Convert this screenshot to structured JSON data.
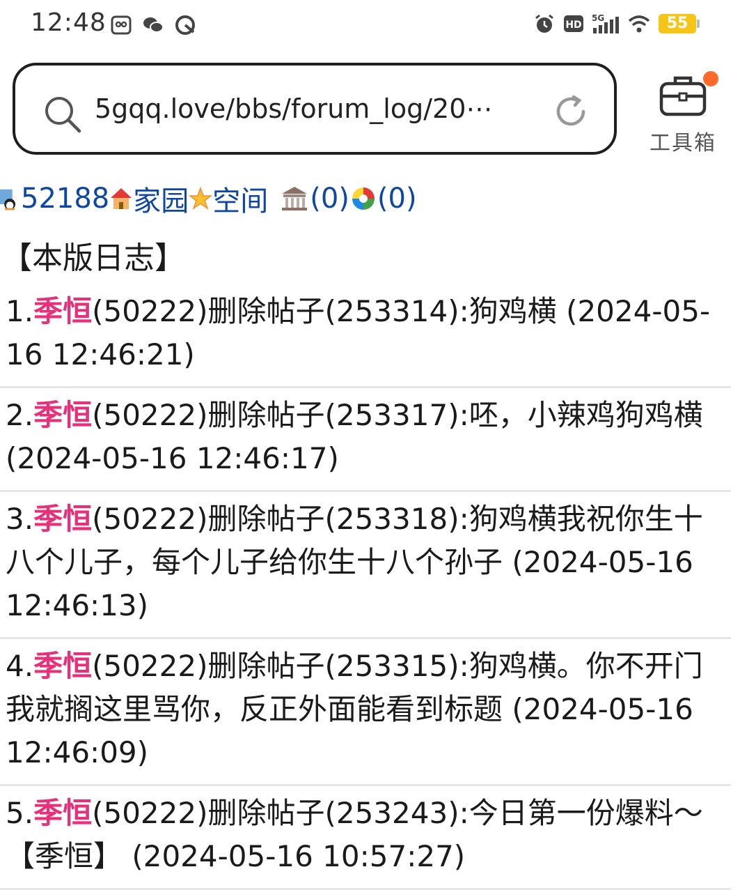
{
  "status_bar": {
    "time": "12:48",
    "battery": "55",
    "network": "5G",
    "hd": "HD"
  },
  "address_bar": {
    "url": "5gqq.love/bbs/forum_log/20⋯",
    "toolbox_label": "工具箱"
  },
  "nav": {
    "user_id": "52188",
    "home": "家园",
    "space": "空间",
    "count1": "(0)",
    "count2": "(0)"
  },
  "section_title": "【本版日志】",
  "logs": [
    {
      "num": "1.",
      "user": "季恒",
      "text": "(50222)删除帖子(253314):狗鸡横 (2024-05-16 12:46:21)"
    },
    {
      "num": "2.",
      "user": "季恒",
      "text": "(50222)删除帖子(253317):呸，小辣鸡狗鸡横 (2024-05-16 12:46:17)"
    },
    {
      "num": "3.",
      "user": "季恒",
      "text": "(50222)删除帖子(253318):狗鸡横我祝你生十八个儿子，每个儿子给你生十八个孙子 (2024-05-16 12:46:13)"
    },
    {
      "num": "4.",
      "user": "季恒",
      "text": "(50222)删除帖子(253315):狗鸡横。你不开门我就搁这里骂你，反正外面能看到标题 (2024-05-16 12:46:09)"
    },
    {
      "num": "5.",
      "user": "季恒",
      "text": "(50222)删除帖子(253243):今日第一份爆料～【季恒】 (2024-05-16 10:57:27)"
    }
  ],
  "colors": {
    "link": "#0d47a1",
    "username": "#e8307a",
    "battery": "#f5c518",
    "notify_dot": "#ff6a2b"
  }
}
